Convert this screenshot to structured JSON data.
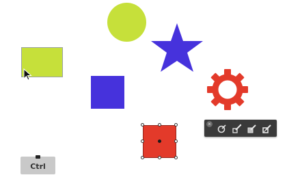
{
  "canvas": {
    "shapes": [
      {
        "kind": "circle",
        "color": "#c6e03a"
      },
      {
        "kind": "star",
        "color": "#4632dc"
      },
      {
        "kind": "rectangle",
        "color": "#c6e03a"
      },
      {
        "kind": "square",
        "color": "#4632dc"
      },
      {
        "kind": "gear",
        "color": "#e33a2a"
      },
      {
        "kind": "square",
        "color": "#e33a2a",
        "selected": true
      }
    ]
  },
  "toolbar": {
    "close_icon": "close-icon",
    "buttons": [
      {
        "icon": "style-icon"
      },
      {
        "icon": "edit-path-icon"
      },
      {
        "icon": "fill-icon"
      },
      {
        "icon": "stroke-icon"
      }
    ]
  },
  "keyboard_hint": {
    "key_label": "Ctrl"
  },
  "cursor": {
    "icon": "pointer-arrow-icon"
  }
}
